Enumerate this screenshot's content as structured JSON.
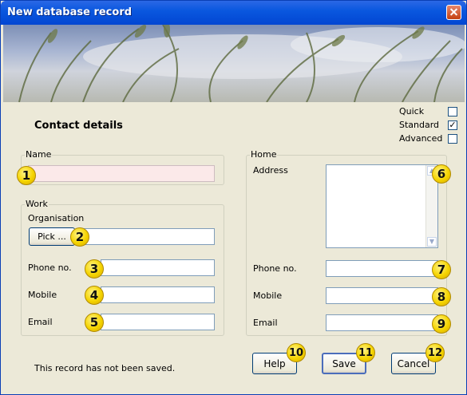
{
  "window": {
    "title": "New database record"
  },
  "section_title": "Contact details",
  "modes": [
    {
      "label": "Quick",
      "checked": false
    },
    {
      "label": "Standard",
      "checked": true
    },
    {
      "label": "Advanced",
      "checked": false
    }
  ],
  "name_group": {
    "legend": "Name",
    "value": ""
  },
  "work_group": {
    "legend": "Work",
    "organisation_label": "Organisation",
    "pick_button": "Pick ...",
    "phone_label": "Phone no.",
    "mobile_label": "Mobile",
    "email_label": "Email"
  },
  "home_group": {
    "legend": "Home",
    "address_label": "Address",
    "phone_label": "Phone no.",
    "mobile_label": "Mobile",
    "email_label": "Email"
  },
  "status_text": "This record has not been saved.",
  "buttons": {
    "help": "Help",
    "save": "Save",
    "cancel": "Cancel"
  },
  "callouts": [
    "1",
    "2",
    "3",
    "4",
    "5",
    "6",
    "7",
    "8",
    "9",
    "10",
    "11",
    "12"
  ],
  "colors": {
    "title_bar": "#0a58df",
    "dialog_bg": "#ece9d8",
    "callout": "#f5d400",
    "required_field": "#fbe9e9"
  },
  "icons": {
    "close": "close-icon",
    "check": "checkmark-icon"
  }
}
